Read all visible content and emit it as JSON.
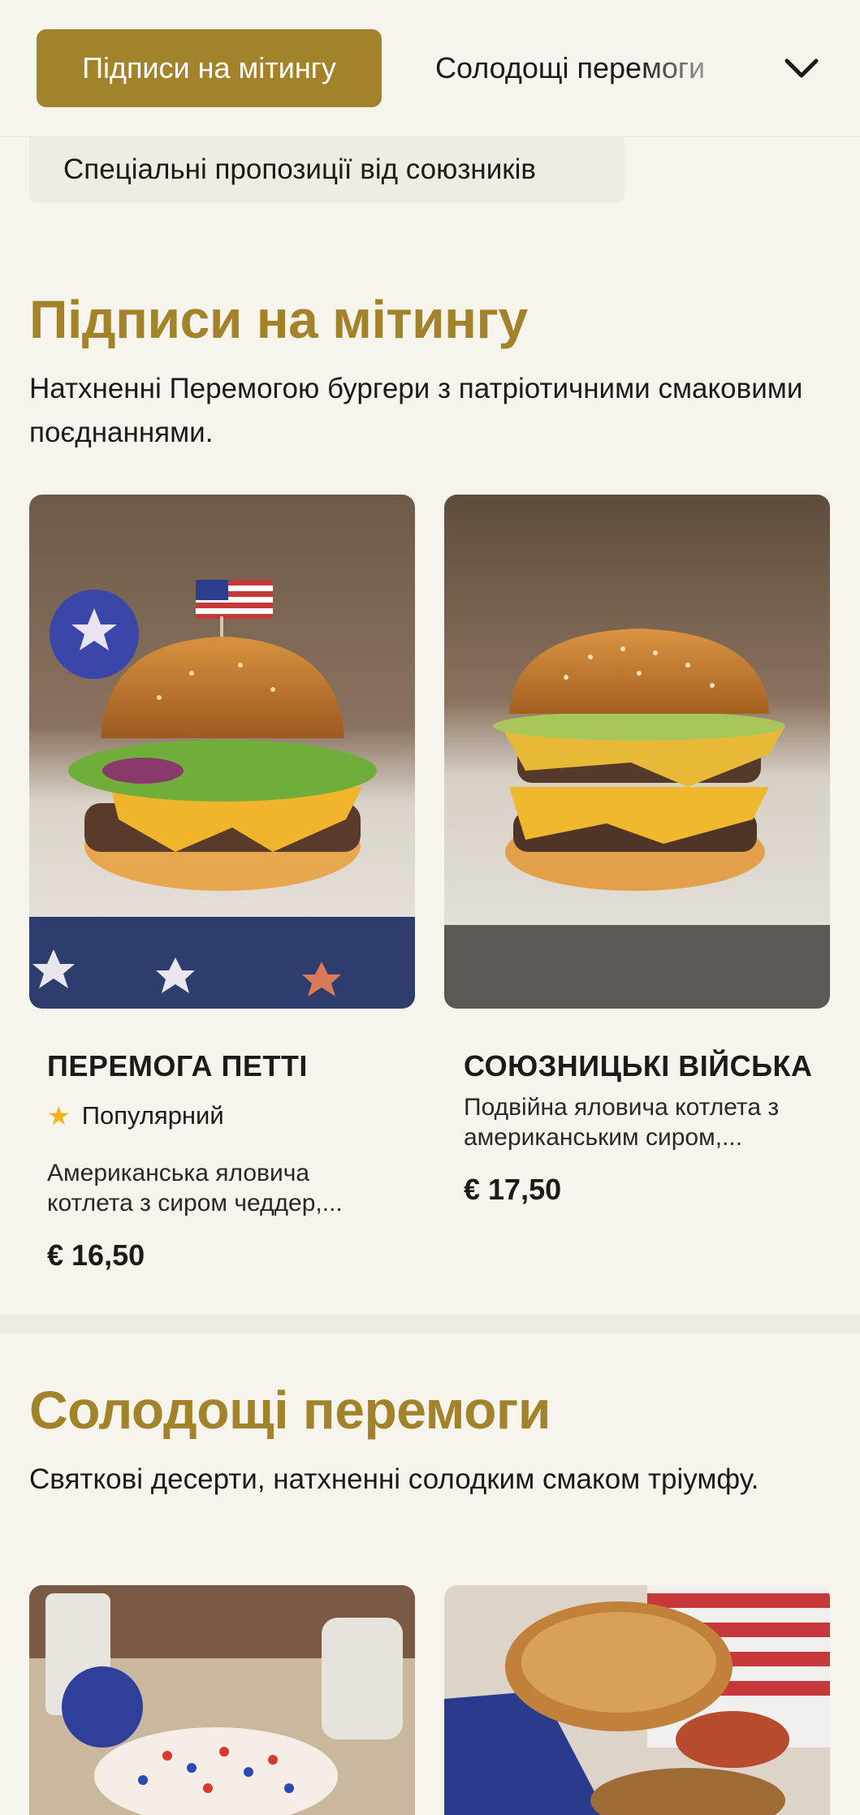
{
  "category_nav": {
    "active": "Підписи на мітингу",
    "next": "Солодощі перемоги",
    "extra": "Спеціальні пропозиції від союзників",
    "expand_icon": "chevron-down-icon"
  },
  "sections": [
    {
      "title": "Підписи на мітингу",
      "description": "Натхненні Перемогою бургери з патріотичними смаковими поєднаннями.",
      "items": [
        {
          "name": "ПЕРЕМОГА ПЕТТІ",
          "badge": "Популярний",
          "badge_icon": "star-icon",
          "description": "Американська яловича котлета з сиром чеддер,...",
          "price": "€ 16,50"
        },
        {
          "name": "СОЮЗНИЦЬКІ ВІЙСЬКА",
          "description": "Подвійна яловича котлета з американським сиром,...",
          "price": "€ 17,50"
        }
      ]
    },
    {
      "title": "Солодощі перемоги",
      "description": "Святкові десерти, натхненні солодким смаком тріумфу."
    }
  ],
  "colors": {
    "accent": "#a2832a",
    "background": "#f7f4ee",
    "pill_bg": "#efece3",
    "star": "#f2b31b"
  }
}
